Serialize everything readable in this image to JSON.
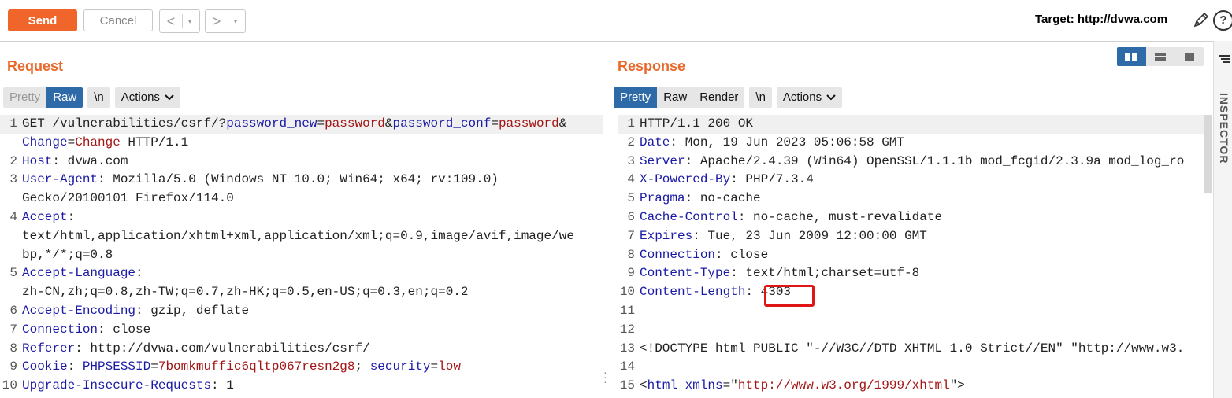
{
  "toolbar": {
    "send_label": "Send",
    "cancel_label": "Cancel",
    "back_glyph": "<",
    "forward_glyph": ">",
    "dropdown_glyph": "▾",
    "target_label": "Target: http://dvwa.com",
    "icons": [
      "pencil-icon",
      "help-icon"
    ]
  },
  "request": {
    "title": "Request",
    "tabs": {
      "pretty": "Pretty",
      "raw": "Raw",
      "active": "raw"
    },
    "newline_label": "\\n",
    "actions_label": "Actions",
    "lines": [
      {
        "n": "1",
        "segments": [
          {
            "t": "GET /vulnerabilities/csrf/?",
            "c": "txt"
          },
          {
            "t": "password_new",
            "c": "k"
          },
          {
            "t": "=",
            "c": "txt"
          },
          {
            "t": "password",
            "c": "v"
          },
          {
            "t": "&",
            "c": "txt"
          },
          {
            "t": "password_conf",
            "c": "k"
          },
          {
            "t": "=",
            "c": "txt"
          },
          {
            "t": "password",
            "c": "v"
          },
          {
            "t": "&",
            "c": "txt"
          }
        ],
        "hl": true
      },
      {
        "n": "",
        "segments": [
          {
            "t": "Change",
            "c": "k"
          },
          {
            "t": "=",
            "c": "txt"
          },
          {
            "t": "Change",
            "c": "v"
          },
          {
            "t": " HTTP/1.1",
            "c": "txt"
          }
        ]
      },
      {
        "n": "2",
        "segments": [
          {
            "t": "Host",
            "c": "k"
          },
          {
            "t": ": dvwa.com",
            "c": "txt"
          }
        ]
      },
      {
        "n": "3",
        "segments": [
          {
            "t": "User-Agent",
            "c": "k"
          },
          {
            "t": ": Mozilla/5.0 (Windows NT 10.0; Win64; x64; rv:109.0)",
            "c": "txt"
          }
        ]
      },
      {
        "n": "",
        "segments": [
          {
            "t": "Gecko/20100101 Firefox/114.0",
            "c": "txt"
          }
        ]
      },
      {
        "n": "4",
        "segments": [
          {
            "t": "Accept",
            "c": "k"
          },
          {
            "t": ":",
            "c": "txt"
          }
        ]
      },
      {
        "n": "",
        "segments": [
          {
            "t": "text/html,application/xhtml+xml,application/xml;q=0.9,image/avif,image/we",
            "c": "txt"
          }
        ]
      },
      {
        "n": "",
        "segments": [
          {
            "t": "bp,*/*;q=0.8",
            "c": "txt"
          }
        ]
      },
      {
        "n": "5",
        "segments": [
          {
            "t": "Accept-Language",
            "c": "k"
          },
          {
            "t": ":",
            "c": "txt"
          }
        ]
      },
      {
        "n": "",
        "segments": [
          {
            "t": "zh-CN,zh;q=0.8,zh-TW;q=0.7,zh-HK;q=0.5,en-US;q=0.3,en;q=0.2",
            "c": "txt"
          }
        ]
      },
      {
        "n": "6",
        "segments": [
          {
            "t": "Accept-Encoding",
            "c": "k"
          },
          {
            "t": ": gzip, deflate",
            "c": "txt"
          }
        ]
      },
      {
        "n": "7",
        "segments": [
          {
            "t": "Connection",
            "c": "k"
          },
          {
            "t": ": close",
            "c": "txt"
          }
        ]
      },
      {
        "n": "8",
        "segments": [
          {
            "t": "Referer",
            "c": "k"
          },
          {
            "t": ": http://dvwa.com/vulnerabilities/csrf/",
            "c": "txt"
          }
        ]
      },
      {
        "n": "9",
        "segments": [
          {
            "t": "Cookie",
            "c": "k"
          },
          {
            "t": ": ",
            "c": "txt"
          },
          {
            "t": "PHPSESSID",
            "c": "k"
          },
          {
            "t": "=",
            "c": "txt"
          },
          {
            "t": "7bomkmuffic6qltp067resn2g8",
            "c": "v"
          },
          {
            "t": "; ",
            "c": "txt"
          },
          {
            "t": "security",
            "c": "k"
          },
          {
            "t": "=",
            "c": "txt"
          },
          {
            "t": "low",
            "c": "v"
          }
        ]
      },
      {
        "n": "10",
        "segments": [
          {
            "t": "Upgrade-Insecure-Requests",
            "c": "k"
          },
          {
            "t": ": 1",
            "c": "txt"
          }
        ]
      }
    ]
  },
  "response": {
    "title": "Response",
    "tabs": {
      "pretty": "Pretty",
      "raw": "Raw",
      "render": "Render",
      "active": "pretty"
    },
    "newline_label": "\\n",
    "actions_label": "Actions",
    "inspector_label": "INSPECTOR",
    "lines": [
      {
        "n": "1",
        "segments": [
          {
            "t": "HTTP/1.1 200 OK",
            "c": "txt"
          }
        ],
        "hl": true
      },
      {
        "n": "2",
        "segments": [
          {
            "t": "Date",
            "c": "k"
          },
          {
            "t": ": Mon, 19 Jun 2023 05:06:58 GMT",
            "c": "txt"
          }
        ]
      },
      {
        "n": "3",
        "segments": [
          {
            "t": "Server",
            "c": "k"
          },
          {
            "t": ": Apache/2.4.39 (Win64) OpenSSL/1.1.1b mod_fcgid/2.3.9a mod_log_ro",
            "c": "txt"
          }
        ]
      },
      {
        "n": "4",
        "segments": [
          {
            "t": "X-Powered-By",
            "c": "k"
          },
          {
            "t": ": PHP/7.3.4",
            "c": "txt"
          }
        ]
      },
      {
        "n": "5",
        "segments": [
          {
            "t": "Pragma",
            "c": "k"
          },
          {
            "t": ": no-cache",
            "c": "txt"
          }
        ]
      },
      {
        "n": "6",
        "segments": [
          {
            "t": "Cache-Control",
            "c": "k"
          },
          {
            "t": ": no-cache, must-revalidate",
            "c": "txt"
          }
        ]
      },
      {
        "n": "7",
        "segments": [
          {
            "t": "Expires",
            "c": "k"
          },
          {
            "t": ": Tue, 23 Jun 2009 12:00:00 GMT",
            "c": "txt"
          }
        ]
      },
      {
        "n": "8",
        "segments": [
          {
            "t": "Connection",
            "c": "k"
          },
          {
            "t": ": close",
            "c": "txt"
          }
        ]
      },
      {
        "n": "9",
        "segments": [
          {
            "t": "Content-Type",
            "c": "k"
          },
          {
            "t": ": text/html;charset=utf-8",
            "c": "txt"
          }
        ]
      },
      {
        "n": "10",
        "segments": [
          {
            "t": "Content-Length",
            "c": "k"
          },
          {
            "t": ": ",
            "c": "txt"
          },
          {
            "t": "4303",
            "c": "txt"
          }
        ]
      },
      {
        "n": "11",
        "segments": [
          {
            "t": "",
            "c": "txt"
          }
        ]
      },
      {
        "n": "12",
        "segments": [
          {
            "t": "",
            "c": "txt"
          }
        ]
      },
      {
        "n": "13",
        "segments": [
          {
            "t": "<!DOCTYPE html PUBLIC \"-//W3C//DTD XHTML 1.0 Strict//EN\" \"http://www.w3.",
            "c": "txt"
          }
        ]
      },
      {
        "n": "14",
        "segments": [
          {
            "t": "",
            "c": "txt"
          }
        ]
      },
      {
        "n": "15",
        "segments": [
          {
            "t": "<",
            "c": "txt"
          },
          {
            "t": "html",
            "c": "k"
          },
          {
            "t": " ",
            "c": "txt"
          },
          {
            "t": "xmlns",
            "c": "k"
          },
          {
            "t": "=\"",
            "c": "txt"
          },
          {
            "t": "http://www.w3.org/1999/xhtml",
            "c": "v"
          },
          {
            "t": "\">",
            "c": "txt"
          }
        ]
      }
    ]
  },
  "colors": {
    "accent": "#f06529",
    "active_tab": "#2e6aa7",
    "highlight_box": "#e01616"
  }
}
